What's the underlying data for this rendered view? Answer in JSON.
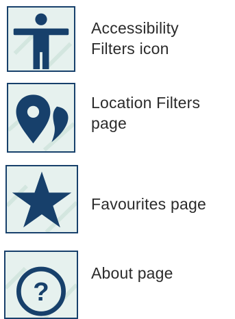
{
  "colors": {
    "icon": "#17406b",
    "tile_bg": "#e6f1ee",
    "text": "#2b2b2b"
  },
  "items": [
    {
      "icon": "accessibility-icon",
      "label": "Accessibility\nFilters icon"
    },
    {
      "icon": "location-icon",
      "label": "Location Filters\npage"
    },
    {
      "icon": "star-icon",
      "label": "Favourites page"
    },
    {
      "icon": "help-icon",
      "label": "About page"
    }
  ]
}
